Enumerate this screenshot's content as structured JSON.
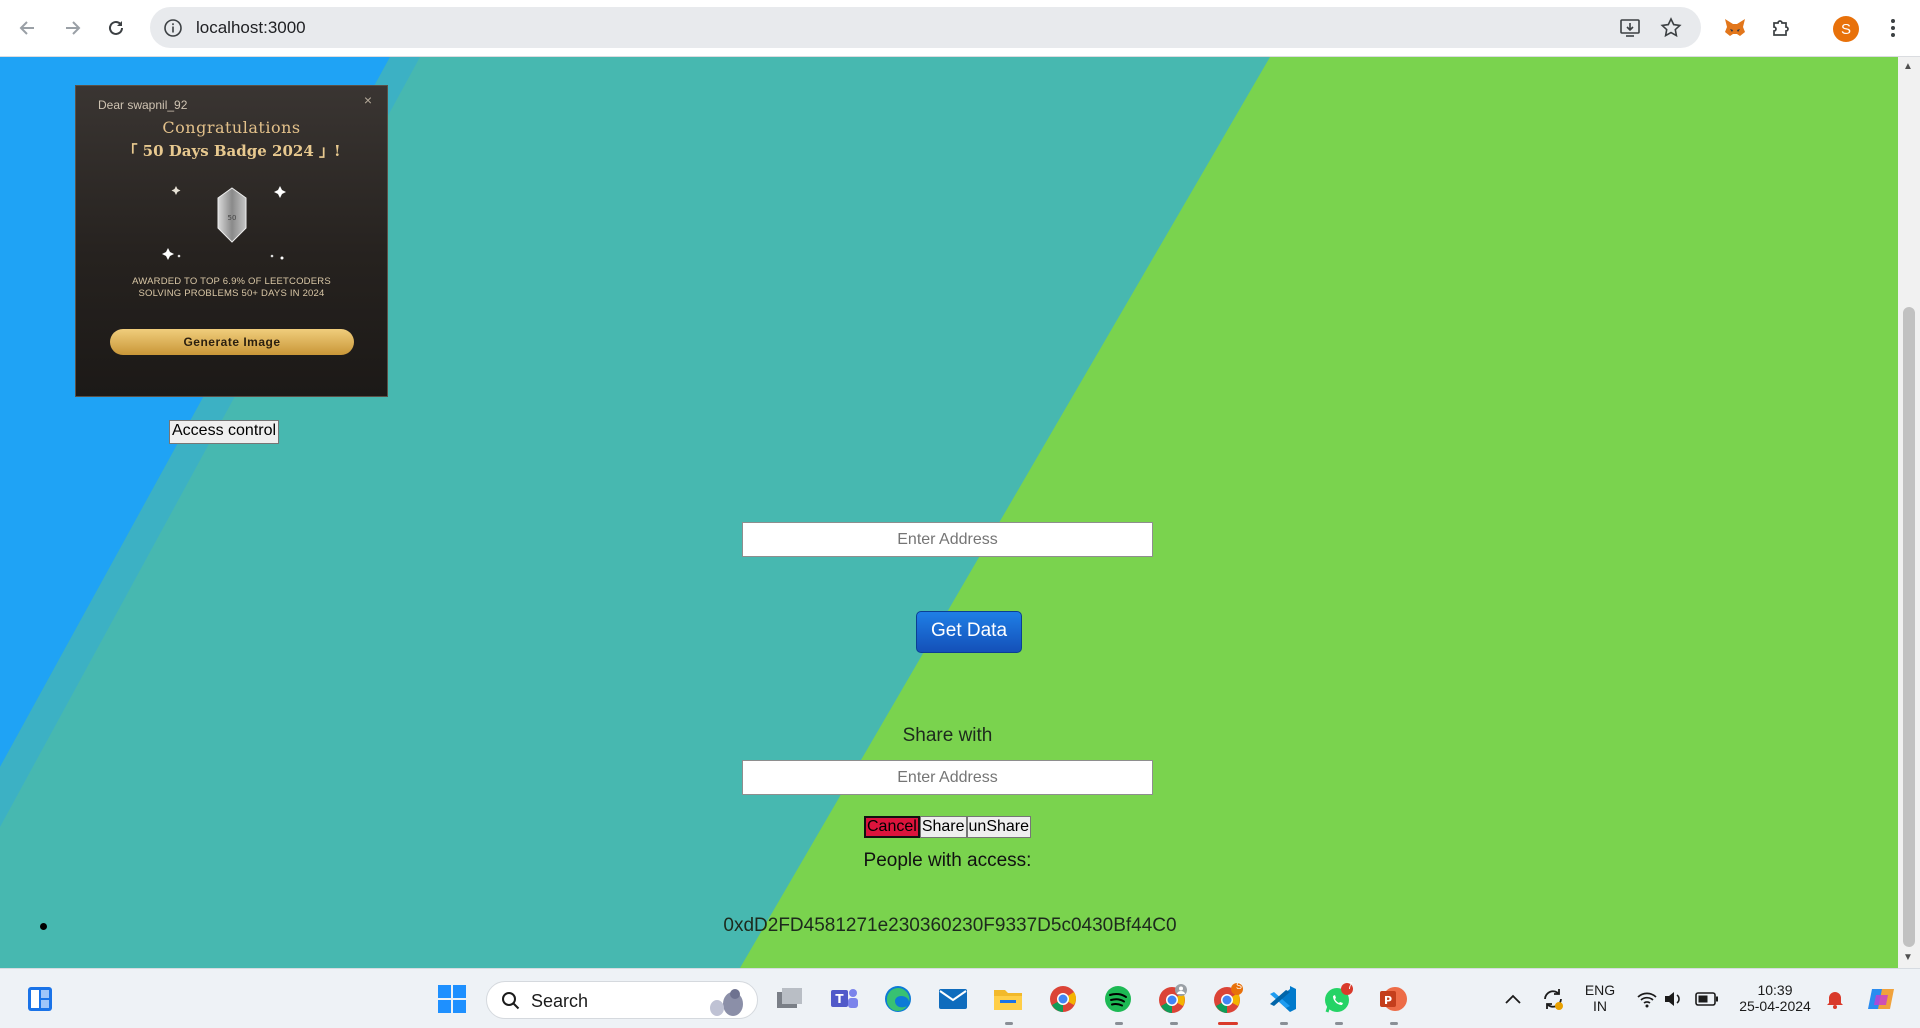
{
  "browser": {
    "url": "localhost:3000",
    "profile_initial": "S"
  },
  "badge_popup": {
    "greeting": "Dear swapnil_92",
    "close_symbol": "×",
    "congrats": "Congratulations",
    "title": "「 50 Days Badge 2024 」!",
    "awarded_line1": "AWARDED TO TOP 6.9% OF LEETCODERS",
    "awarded_line2": "SOLVING PROBLEMS 50+ DAYS IN 2024",
    "generate_button": "Generate Image"
  },
  "page": {
    "access_control_button": "Access control",
    "address_input": {
      "placeholder": "Enter Address",
      "value": ""
    },
    "get_data_button": "Get Data",
    "share_with_label": "Share with",
    "share_input": {
      "placeholder": "Enter Address",
      "value": ""
    },
    "cancel_button": "Cancel",
    "share_button": "Share",
    "unshare_button": "unShare",
    "people_with_access_label": "People with access:",
    "access_list": [
      "0xdD2FD4581271e230360230F9337D5c0430Bf44C0"
    ]
  },
  "taskbar": {
    "search_label": "Search",
    "whatsapp_badge": "7",
    "chrome_profile_badge": "S",
    "language_top": "ENG",
    "language_bottom": "IN",
    "time": "10:39",
    "date": "25-04-2024"
  },
  "colors": {
    "bg_blue": "#1fa3f5",
    "bg_teal": "#47b8b0",
    "bg_green": "#7ad34e",
    "get_data_button": "#1761c9",
    "cancel_button": "#dc143c"
  }
}
